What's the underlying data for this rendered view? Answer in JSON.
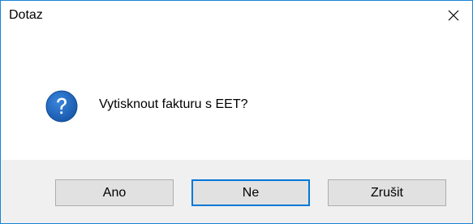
{
  "window": {
    "title": "Dotaz"
  },
  "dialog": {
    "icon": "question-icon",
    "message": "Vytisknout fakturu s EET?"
  },
  "buttons": {
    "yes_label": "Ano",
    "no_label": "Ne",
    "cancel_label": "Zrušit",
    "default": "no"
  },
  "colors": {
    "border_accent": "#1883d7",
    "icon_blue": "#1e5fb4",
    "footer_bg": "#f0f0f0",
    "button_bg": "#e1e1e1",
    "default_button_border": "#0078d7"
  }
}
